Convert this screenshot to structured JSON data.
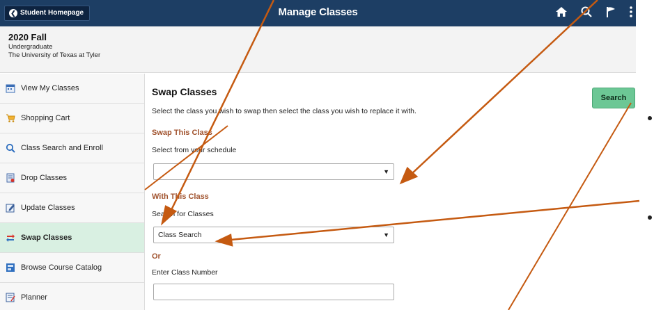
{
  "header": {
    "back_label": "Student Homepage",
    "title": "Manage Classes",
    "icons": [
      "home-icon",
      "search-icon",
      "flag-icon",
      "more-vertical-icon"
    ]
  },
  "context": {
    "term": "2020 Fall",
    "career": "Undergraduate",
    "institution": "The University of Texas at Tyler"
  },
  "sidebar": {
    "items": [
      {
        "label": "View My Classes",
        "icon": "calendar-icon"
      },
      {
        "label": "Shopping Cart",
        "icon": "cart-icon"
      },
      {
        "label": "Class Search and Enroll",
        "icon": "search-icon"
      },
      {
        "label": "Drop Classes",
        "icon": "drop-icon"
      },
      {
        "label": "Update Classes",
        "icon": "edit-icon"
      },
      {
        "label": "Swap Classes",
        "icon": "swap-icon",
        "active": true
      },
      {
        "label": "Browse Course Catalog",
        "icon": "catalog-icon"
      },
      {
        "label": "Planner",
        "icon": "planner-icon"
      }
    ]
  },
  "main": {
    "title": "Swap Classes",
    "instructions": "Select the class you wish to swap then select the class you wish to replace it with.",
    "swap_section": "Swap This Class",
    "swap_field_label": "Select from your schedule",
    "swap_select_value": "",
    "with_section": "With This Class",
    "with_field_label": "Search for Classes",
    "with_select_value": "Class Search",
    "or_label": "Or",
    "class_number_label": "Enter Class Number",
    "class_number_value": "",
    "search_button": "Search"
  },
  "annotations": {
    "arrow_color": "#c55a11",
    "bullet_count": 2
  }
}
